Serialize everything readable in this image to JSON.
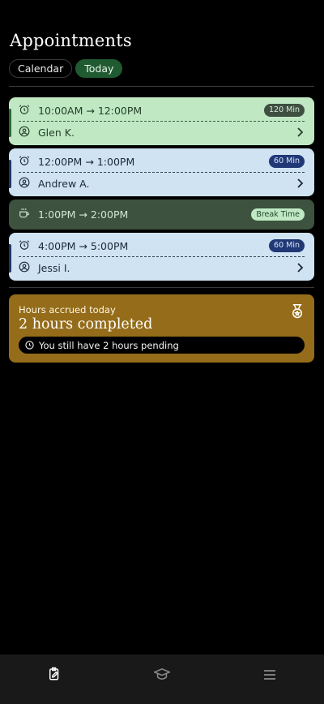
{
  "page": {
    "title": "Appointments"
  },
  "tabs": [
    {
      "label": "Calendar",
      "active": false
    },
    {
      "label": "Today",
      "active": true
    }
  ],
  "appointments": [
    {
      "start": "10:00AM",
      "end": "12:00PM",
      "duration": "120 Min",
      "client": "Glen K.",
      "theme": "green"
    },
    {
      "start": "12:00PM",
      "end": "1:00PM",
      "duration": "60 Min",
      "client": "Andrew A.",
      "theme": "blue"
    },
    {
      "start": "4:00PM",
      "end": "5:00PM",
      "duration": "60 Min",
      "client": "Jessi I.",
      "theme": "blue"
    }
  ],
  "break": {
    "start": "1:00PM",
    "end": "2:00PM",
    "label": "Break Time"
  },
  "hours": {
    "label": "Hours accrued today",
    "completed": "2 hours completed",
    "pending": "You still have 2 hours pending"
  },
  "nav": [
    {
      "icon": "clipboard-edit-icon",
      "active": true
    },
    {
      "icon": "graduation-cap-icon",
      "active": false
    },
    {
      "icon": "menu-icon",
      "active": false
    }
  ],
  "colors": {
    "green_card": "#bfe8c3",
    "blue_card": "#cfe3f3",
    "break_card": "#3d523f",
    "hours_card": "#946c1a",
    "active_tab": "#1f5a31"
  }
}
